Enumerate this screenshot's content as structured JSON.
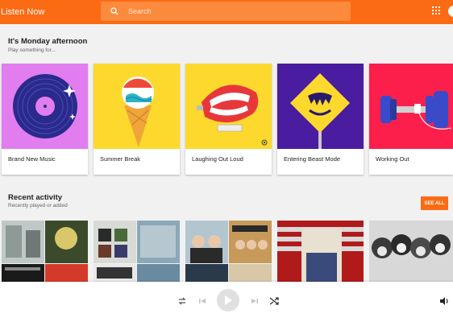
{
  "app": {
    "title": "Listen Now"
  },
  "search": {
    "placeholder": "Search"
  },
  "section1": {
    "title": "It's Monday afternoon",
    "subtitle": "Play something for..."
  },
  "cards": [
    {
      "label": "Brand New Music"
    },
    {
      "label": "Summer Break"
    },
    {
      "label": "Laughing Out Loud"
    },
    {
      "label": "Entering Beast Mode"
    },
    {
      "label": "Working Out"
    }
  ],
  "section2": {
    "title": "Recent activity",
    "subtitle": "Recently played or added",
    "see_all": "SEE ALL"
  },
  "colors": {
    "accent": "#fb6b14",
    "card1": "#e27df0",
    "card2": "#fdd92d",
    "card3": "#fdd92d",
    "card4": "#4a1ca0",
    "card5": "#fc1f4c"
  },
  "player": {
    "icons": [
      "repeat-icon",
      "previous-icon",
      "play-icon",
      "next-icon",
      "shuffle-icon",
      "volume-icon"
    ]
  }
}
